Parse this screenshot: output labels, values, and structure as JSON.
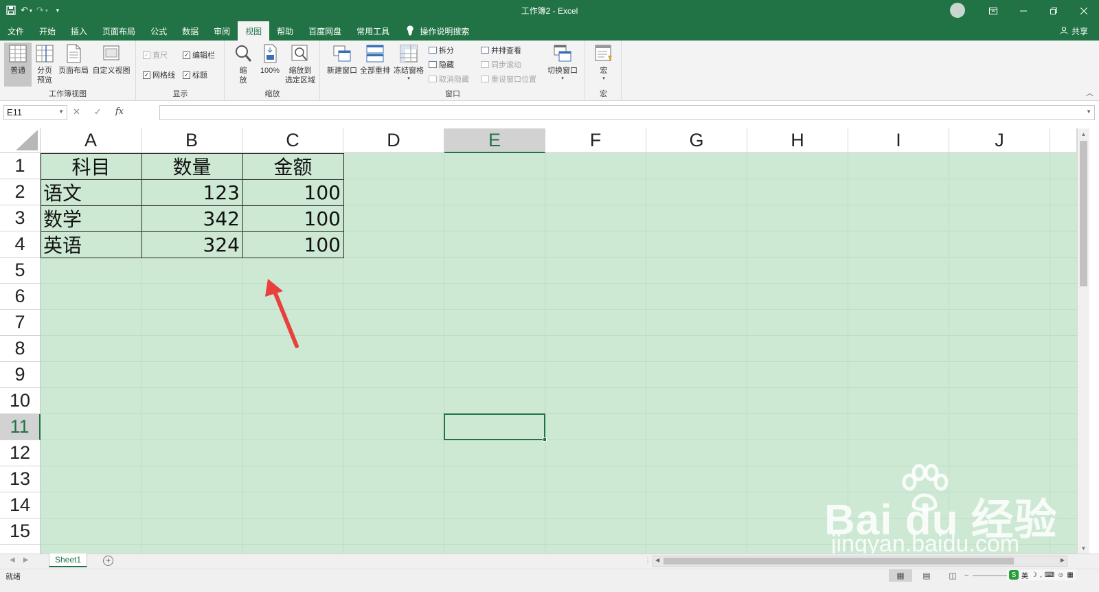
{
  "title_bar": {
    "window_title": "工作簿2 - Excel",
    "qat_icons": [
      "save-icon",
      "undo-icon",
      "redo-icon",
      "customize-icon"
    ],
    "controls": [
      "ribbon-display-icon",
      "minimize-icon",
      "restore-icon",
      "close-icon"
    ]
  },
  "menu": {
    "tabs": [
      {
        "label": "文件"
      },
      {
        "label": "开始"
      },
      {
        "label": "插入"
      },
      {
        "label": "页面布局"
      },
      {
        "label": "公式"
      },
      {
        "label": "数据"
      },
      {
        "label": "审阅"
      },
      {
        "label": "视图",
        "active": true
      },
      {
        "label": "帮助"
      },
      {
        "label": "百度网盘"
      },
      {
        "label": "常用工具"
      }
    ],
    "tell_me": "操作说明搜索",
    "share": "共享"
  },
  "ribbon": {
    "workbook_views": {
      "label": "工作簿视图",
      "normal": "普通",
      "page_break_line1": "分页",
      "page_break_line2": "预览",
      "page_layout": "页面布局",
      "custom_views": "自定义视图"
    },
    "show": {
      "label": "显示",
      "ruler": "直尺",
      "formula_bar": "编辑栏",
      "gridlines": "网格线",
      "headings": "标题"
    },
    "zoom": {
      "label": "缩放",
      "zoom_line1": "缩",
      "zoom_line2": "放",
      "hundred": "100%",
      "zoom_sel_line1": "缩放到",
      "zoom_sel_line2": "选定区域"
    },
    "window": {
      "label": "窗口",
      "new_window": "新建窗口",
      "arrange_all": "全部重排",
      "freeze_panes": "冻结窗格",
      "split": "拆分",
      "hide": "隐藏",
      "unhide": "取消隐藏",
      "side_by_side": "并排查看",
      "sync_scroll": "同步滚动",
      "reset_position": "重设窗口位置",
      "switch_windows": "切换窗口"
    },
    "macros": {
      "label": "宏",
      "macros": "宏"
    }
  },
  "formula_bar": {
    "name_box": "E11",
    "fx": "fx",
    "content": ""
  },
  "sheet": {
    "columns": [
      "A",
      "B",
      "C",
      "D",
      "E",
      "F",
      "G",
      "H",
      "I",
      "J"
    ],
    "rows": [
      "1",
      "2",
      "3",
      "4",
      "5",
      "6",
      "7",
      "8",
      "9",
      "10",
      "11",
      "12",
      "13",
      "14",
      "15"
    ],
    "selected_cell": "E11",
    "cells": {
      "A1": "科目",
      "B1": "数量",
      "C1": "金额",
      "A2": "语文",
      "B2": "123",
      "C2": "100",
      "A3": "数学",
      "B3": "342",
      "C3": "100",
      "A4": "英语",
      "B4": "324",
      "C4": "100"
    },
    "fill_color": "#cde8d3",
    "accent": "#217346",
    "annotation_arrow_color": "#e8413c"
  },
  "sheet_tabs": {
    "tabs": [
      "Sheet1"
    ],
    "add_icon": "plus-circle-icon"
  },
  "status_bar": {
    "status": "就绪",
    "view_icons": [
      "normal-view-icon",
      "page-layout-view-icon",
      "page-break-view-icon"
    ],
    "ime_label": "英"
  },
  "watermark": {
    "main": "Bai du 经验",
    "sub": "jingyan.baidu.com"
  }
}
